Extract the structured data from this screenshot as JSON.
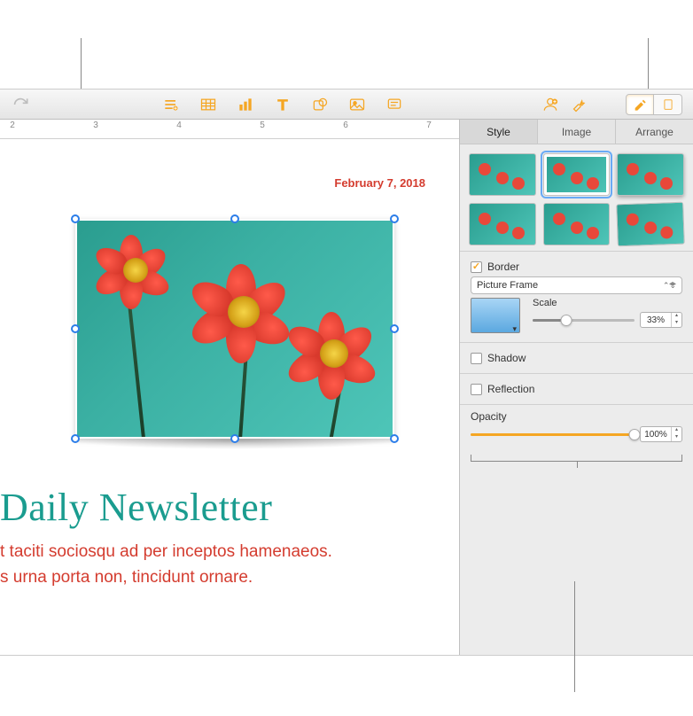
{
  "ruler": {
    "labels": [
      "2",
      "3",
      "4",
      "5",
      "6",
      "7"
    ]
  },
  "document": {
    "date": "February 7, 2018",
    "title": "Daily Newsletter",
    "body_line1": "t taciti sociosqu ad per inceptos hamenaeos.",
    "body_line2": "s urna porta non, tincidunt ornare."
  },
  "inspector": {
    "tabs": {
      "style": "Style",
      "image": "Image",
      "arrange": "Arrange"
    },
    "border": {
      "label": "Border",
      "type_label": "Picture Frame",
      "scale_label": "Scale",
      "scale_value": "33%",
      "scale_percent": 33
    },
    "shadow_label": "Shadow",
    "reflection_label": "Reflection",
    "opacity": {
      "label": "Opacity",
      "value": "100%",
      "percent": 100
    }
  }
}
